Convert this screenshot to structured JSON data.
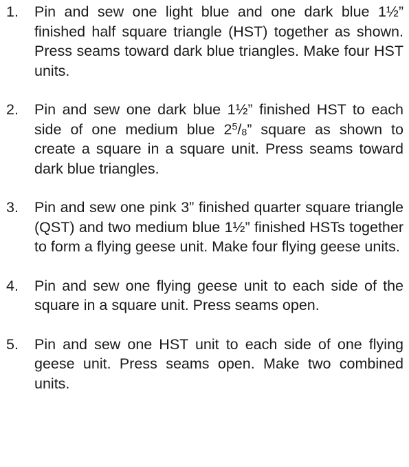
{
  "steps": [
    {
      "number": "1.",
      "text": "Pin and sew one light blue and one dark blue 1½” finished half square triangle (HST) together as shown.  Press seams toward dark blue triangles.  Make four HST units."
    },
    {
      "number": "2.",
      "text_before": "Pin and sew one dark blue 1½” finished HST to each side of one medium blue 2",
      "frac_num": "5",
      "frac_sep": "/",
      "frac_den": "8",
      "text_after": "” square as shown to create a square in a square unit.  Press seams toward dark blue triangles."
    },
    {
      "number": "3.",
      "text": "Pin and sew one pink 3” finished quarter square triangle (QST) and two medium blue 1½” finished HSTs together to form a flying geese unit.  Make four flying geese units."
    },
    {
      "number": "4.",
      "text": "Pin and sew one flying geese unit to each side of the square in a square unit.  Press seams open."
    },
    {
      "number": "5.",
      "text": "Pin and sew one HST unit to each side of one flying geese unit.  Press seams open.  Make two combined units."
    }
  ]
}
